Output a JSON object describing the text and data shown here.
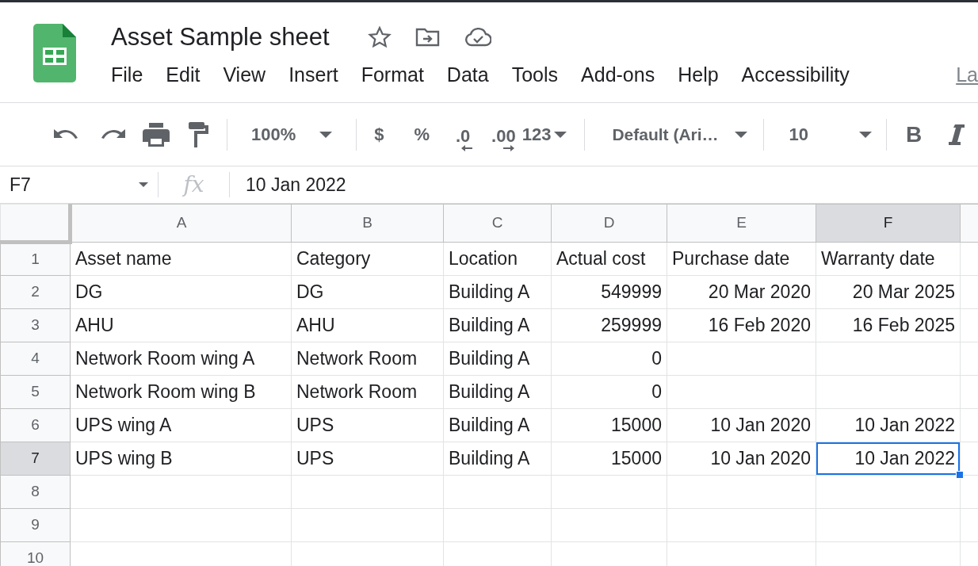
{
  "document": {
    "title": "Asset Sample sheet"
  },
  "menu": [
    {
      "label": "File"
    },
    {
      "label": "Edit"
    },
    {
      "label": "View"
    },
    {
      "label": "Insert"
    },
    {
      "label": "Format"
    },
    {
      "label": "Data"
    },
    {
      "label": "Tools"
    },
    {
      "label": "Add-ons"
    },
    {
      "label": "Help"
    },
    {
      "label": "Accessibility"
    }
  ],
  "menu_link": "La",
  "toolbar": {
    "zoom": "100%",
    "currency": "$",
    "percent": "%",
    "decrease_decimals": ".0",
    "increase_decimals": ".00",
    "more_formats": "123",
    "font": "Default (Ari…",
    "font_size": "10",
    "bold": "B"
  },
  "formula_bar": {
    "cell_ref": "F7",
    "fx": "fx",
    "value": "10 Jan 2022"
  },
  "sheet": {
    "columns": [
      {
        "label": "A",
        "kind": "text",
        "selected": false
      },
      {
        "label": "B",
        "kind": "text",
        "selected": false
      },
      {
        "label": "C",
        "kind": "text",
        "selected": false
      },
      {
        "label": "D",
        "kind": "number",
        "selected": false
      },
      {
        "label": "E",
        "kind": "date",
        "selected": false
      },
      {
        "label": "F",
        "kind": "date",
        "selected": true
      }
    ],
    "rows": [
      {
        "number": "1",
        "kind": "labels",
        "selected": false,
        "cells": [
          "Asset name",
          "Category",
          "Location",
          "Actual cost",
          "Purchase date",
          "Warranty date"
        ]
      },
      {
        "number": "2",
        "kind": "data",
        "selected": false,
        "cells": [
          "DG",
          "DG",
          "Building A",
          "549999",
          "20 Mar 2020",
          "20 Mar 2025"
        ]
      },
      {
        "number": "3",
        "kind": "data",
        "selected": false,
        "cells": [
          "AHU",
          "AHU",
          "Building A",
          "259999",
          "16 Feb 2020",
          "16 Feb 2025"
        ]
      },
      {
        "number": "4",
        "kind": "data",
        "selected": false,
        "cells": [
          "Network Room wing A",
          "Network Room",
          "Building A",
          "0",
          null,
          null
        ]
      },
      {
        "number": "5",
        "kind": "data",
        "selected": false,
        "cells": [
          "Network Room wing B",
          "Network Room",
          "Building A",
          "0",
          null,
          null
        ]
      },
      {
        "number": "6",
        "kind": "data",
        "selected": false,
        "cells": [
          "UPS wing A",
          "UPS",
          "Building A",
          "15000",
          "10 Jan 2020",
          "10 Jan 2022"
        ]
      },
      {
        "number": "7",
        "kind": "data",
        "selected": true,
        "cells": [
          "UPS wing B",
          "UPS",
          "Building A",
          "15000",
          "10 Jan 2020",
          "10 Jan 2022"
        ]
      },
      {
        "number": "8",
        "kind": "data",
        "selected": false,
        "cells": []
      },
      {
        "number": "9",
        "kind": "data",
        "selected": false,
        "cells": []
      },
      {
        "number": "10",
        "kind": "data",
        "selected": false,
        "cells": []
      }
    ]
  }
}
